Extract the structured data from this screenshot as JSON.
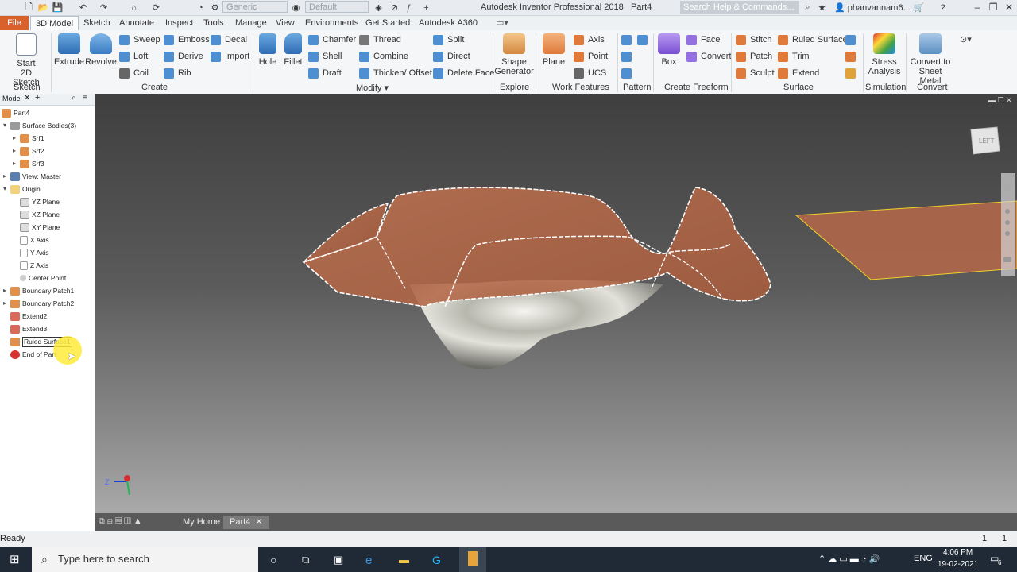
{
  "titlebar": {
    "visual_style": "Generic",
    "appearance": "Default",
    "app_title": "Autodesk Inventor Professional 2018",
    "doc_name": "Part4",
    "search_placeholder": "Search Help & Commands...",
    "user": "phanvannam6..."
  },
  "tabs": [
    "File",
    "3D Model",
    "Sketch",
    "Annotate",
    "Inspect",
    "Tools",
    "Manage",
    "View",
    "Environments",
    "Get Started",
    "Autodesk A360"
  ],
  "ribbon": {
    "sketch": {
      "start_sketch": "Start",
      "start_sketch2": "2D Sketch",
      "title": "Sketch"
    },
    "create": {
      "extrude": "Extrude",
      "revolve": "Revolve",
      "sweep": "Sweep",
      "loft": "Loft",
      "coil": "Coil",
      "emboss": "Emboss",
      "derive": "Derive",
      "rib": "Rib",
      "decal": "Decal",
      "import": "Import",
      "title": "Create"
    },
    "modify": {
      "hole": "Hole",
      "fillet": "Fillet",
      "chamfer": "Chamfer",
      "shell": "Shell",
      "draft": "Draft",
      "thread": "Thread",
      "combine": "Combine",
      "thicken": "Thicken/ Offset",
      "split": "Split",
      "direct": "Direct",
      "delete_face": "Delete Face",
      "title": "Modify ▾"
    },
    "explore": {
      "shape_gen": "Shape",
      "shape_gen2": "Generator",
      "title": "Explore"
    },
    "work": {
      "plane": "Plane",
      "axis": "Axis",
      "point": "Point",
      "ucs": "UCS",
      "title": "Work Features"
    },
    "pattern": {
      "title": "Pattern"
    },
    "freeform": {
      "box": "Box",
      "face": "Face",
      "convert": "Convert",
      "title": "Create Freeform"
    },
    "surface": {
      "stitch": "Stitch",
      "patch": "Patch",
      "sculpt": "Sculpt",
      "ruled": "Ruled Surface",
      "trim": "Trim",
      "extend": "Extend",
      "title": "Surface"
    },
    "simulation": {
      "stress": "Stress",
      "stress2": "Analysis",
      "title": "Simulation"
    },
    "convert": {
      "sheet": "Convert to",
      "sheet2": "Sheet Metal",
      "title": "Convert"
    }
  },
  "browser": {
    "title": "Model",
    "items": [
      {
        "label": "Part4",
        "level": 0,
        "tw": ""
      },
      {
        "label": "Surface Bodies(3)",
        "level": 0,
        "tw": "▾"
      },
      {
        "label": "Srf1",
        "level": 1,
        "tw": "▸"
      },
      {
        "label": "Srf2",
        "level": 1,
        "tw": "▸"
      },
      {
        "label": "Srf3",
        "level": 1,
        "tw": "▸"
      },
      {
        "label": "View: Master",
        "level": 0,
        "tw": "▸"
      },
      {
        "label": "Origin",
        "level": 0,
        "tw": "▾"
      },
      {
        "label": "YZ Plane",
        "level": 1,
        "tw": ""
      },
      {
        "label": "XZ Plane",
        "level": 1,
        "tw": ""
      },
      {
        "label": "XY Plane",
        "level": 1,
        "tw": ""
      },
      {
        "label": "X Axis",
        "level": 1,
        "tw": ""
      },
      {
        "label": "Y Axis",
        "level": 1,
        "tw": ""
      },
      {
        "label": "Z Axis",
        "level": 1,
        "tw": ""
      },
      {
        "label": "Center Point",
        "level": 1,
        "tw": ""
      },
      {
        "label": "Boundary Patch1",
        "level": 0,
        "tw": "▸"
      },
      {
        "label": "Boundary Patch2",
        "level": 0,
        "tw": "▸"
      },
      {
        "label": "Extend2",
        "level": 0,
        "tw": ""
      },
      {
        "label": "Extend3",
        "level": 0,
        "tw": ""
      },
      {
        "label": "Ruled Surface1",
        "level": 0,
        "tw": ""
      },
      {
        "label": "End of Part",
        "level": 0,
        "tw": ""
      }
    ]
  },
  "viewcube_label": "LEFT",
  "triad": {
    "z": "Z"
  },
  "doc_tabs": {
    "home": "My Home",
    "part": "Part4",
    "close": "✕"
  },
  "status": {
    "text": "Ready",
    "count1": "1",
    "count2": "1"
  },
  "taskbar": {
    "search": "Type here to search",
    "lang": "ENG",
    "time": "4:06 PM",
    "date": "19-02-2021",
    "notif": "6"
  },
  "colors": {
    "file_tab": "#d9612c",
    "surface": "#c8704a",
    "highlight": "#ffeb3b"
  }
}
